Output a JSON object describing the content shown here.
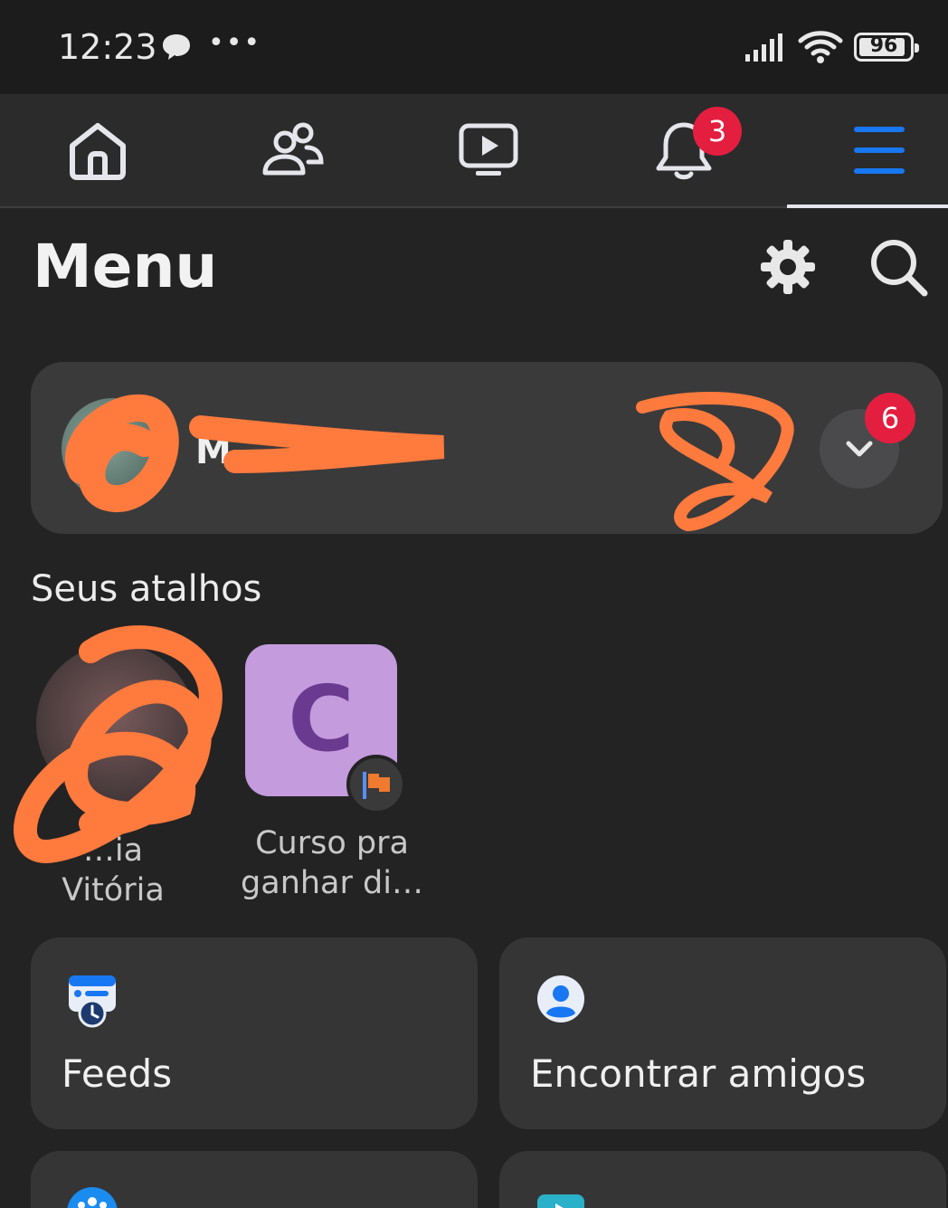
{
  "status_bar": {
    "time": "12:23",
    "more": "•••",
    "battery": "96"
  },
  "nav": {
    "tabs": [
      {
        "name": "home",
        "icon": "home-icon"
      },
      {
        "name": "friends",
        "icon": "friends-icon"
      },
      {
        "name": "watch",
        "icon": "video-icon"
      },
      {
        "name": "notifications",
        "icon": "bell-icon",
        "badge": "3"
      },
      {
        "name": "menu",
        "icon": "hamburger-icon",
        "active": true
      }
    ],
    "notifications_badge": "3",
    "accent_color": "#1877f2"
  },
  "header": {
    "title": "Menu"
  },
  "profile": {
    "name": "M",
    "badge": "6"
  },
  "shortcuts": {
    "title": "Seus atalhos",
    "items": [
      {
        "label_line1": "…ia",
        "label_line2": "Vitória"
      },
      {
        "letter": "C",
        "label_line1": "Curso pra",
        "label_line2": "ganhar di…"
      }
    ]
  },
  "tiles": [
    {
      "label": "Feeds",
      "icon": "feeds-icon"
    },
    {
      "label": "Encontrar amigos",
      "icon": "find-friends-icon"
    }
  ]
}
